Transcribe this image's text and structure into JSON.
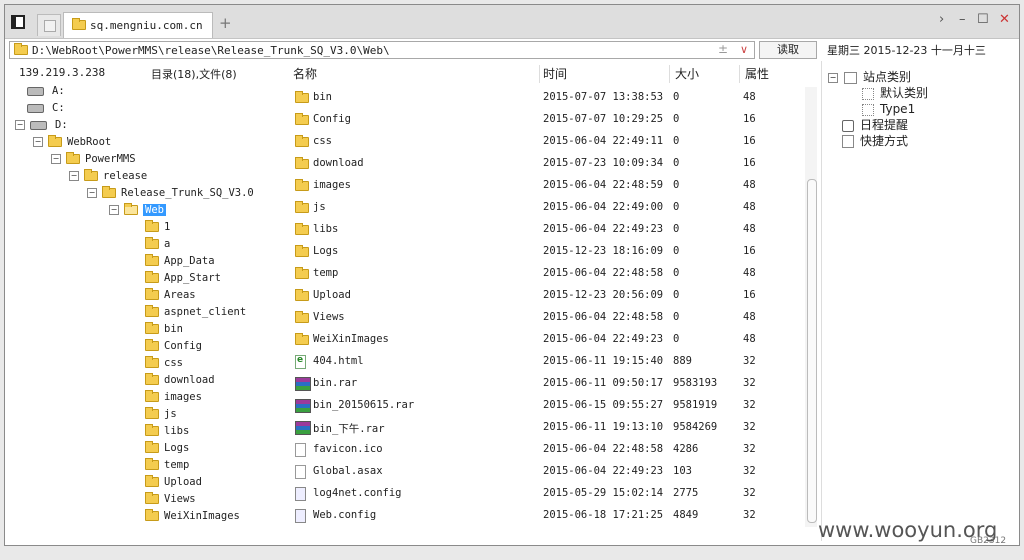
{
  "tabbar": {
    "tab_label": "sq.mengniu.com.cn",
    "plus": "+",
    "controls": [
      "›",
      "–",
      "☐",
      "✕"
    ]
  },
  "address": {
    "path": "D:\\WebRoot\\PowerMMS\\release\\Release_Trunk_SQ_V3.0\\Web\\",
    "read_label": "读取",
    "plus_minus": "±",
    "dropdown": "∨"
  },
  "date": "星期三  2015-12-23  十一月十三",
  "left": {
    "ip": "139.219.3.238",
    "count": "目录(18),文件(8)"
  },
  "tree": [
    {
      "label": "A:",
      "kind": "drive",
      "exp": ""
    },
    {
      "label": "C:",
      "kind": "drive",
      "exp": ""
    },
    {
      "label": "D:",
      "kind": "drive",
      "exp": "−"
    },
    {
      "label": "WebRoot",
      "kind": "folder",
      "exp": "−"
    },
    {
      "label": "PowerMMS",
      "kind": "folder",
      "exp": "−"
    },
    {
      "label": "release",
      "kind": "folder",
      "exp": "−"
    },
    {
      "label": "Release_Trunk_SQ_V3.0",
      "kind": "folder",
      "exp": "−"
    },
    {
      "label": "Web",
      "kind": "folder",
      "exp": "−",
      "selected": true
    },
    {
      "label": "1",
      "kind": "folder",
      "exp": ""
    },
    {
      "label": "a",
      "kind": "folder",
      "exp": ""
    },
    {
      "label": "App_Data",
      "kind": "folder",
      "exp": ""
    },
    {
      "label": "App_Start",
      "kind": "folder",
      "exp": ""
    },
    {
      "label": "Areas",
      "kind": "folder",
      "exp": ""
    },
    {
      "label": "aspnet_client",
      "kind": "folder",
      "exp": ""
    },
    {
      "label": "bin",
      "kind": "folder",
      "exp": ""
    },
    {
      "label": "Config",
      "kind": "folder",
      "exp": ""
    },
    {
      "label": "css",
      "kind": "folder",
      "exp": ""
    },
    {
      "label": "download",
      "kind": "folder",
      "exp": ""
    },
    {
      "label": "images",
      "kind": "folder",
      "exp": ""
    },
    {
      "label": "js",
      "kind": "folder",
      "exp": ""
    },
    {
      "label": "libs",
      "kind": "folder",
      "exp": ""
    },
    {
      "label": "Logs",
      "kind": "folder",
      "exp": ""
    },
    {
      "label": "temp",
      "kind": "folder",
      "exp": ""
    },
    {
      "label": "Upload",
      "kind": "folder",
      "exp": ""
    },
    {
      "label": "Views",
      "kind": "folder",
      "exp": ""
    },
    {
      "label": "WeiXinImages",
      "kind": "folder",
      "exp": ""
    }
  ],
  "columns": {
    "name": "名称",
    "time": "时间",
    "size": "大小",
    "attr": "属性"
  },
  "files": [
    {
      "name": "bin",
      "icon": "folder",
      "time": "2015-07-07 13:38:53",
      "size": "0",
      "attr": "48"
    },
    {
      "name": "Config",
      "icon": "folder",
      "time": "2015-07-07 10:29:25",
      "size": "0",
      "attr": "16"
    },
    {
      "name": "css",
      "icon": "folder",
      "time": "2015-06-04 22:49:11",
      "size": "0",
      "attr": "16"
    },
    {
      "name": "download",
      "icon": "folder",
      "time": "2015-07-23 10:09:34",
      "size": "0",
      "attr": "16"
    },
    {
      "name": "images",
      "icon": "folder",
      "time": "2015-06-04 22:48:59",
      "size": "0",
      "attr": "48"
    },
    {
      "name": "js",
      "icon": "folder",
      "time": "2015-06-04 22:49:00",
      "size": "0",
      "attr": "48"
    },
    {
      "name": "libs",
      "icon": "folder",
      "time": "2015-06-04 22:49:23",
      "size": "0",
      "attr": "48"
    },
    {
      "name": "Logs",
      "icon": "folder",
      "time": "2015-12-23 18:16:09",
      "size": "0",
      "attr": "16"
    },
    {
      "name": "temp",
      "icon": "folder",
      "time": "2015-06-04 22:48:58",
      "size": "0",
      "attr": "48"
    },
    {
      "name": "Upload",
      "icon": "folder",
      "time": "2015-12-23 20:56:09",
      "size": "0",
      "attr": "16"
    },
    {
      "name": "Views",
      "icon": "folder",
      "time": "2015-06-04 22:48:58",
      "size": "0",
      "attr": "48"
    },
    {
      "name": "WeiXinImages",
      "icon": "folder",
      "time": "2015-06-04 22:49:23",
      "size": "0",
      "attr": "48"
    },
    {
      "name": "404.html",
      "icon": "html",
      "time": "2015-06-11 19:15:40",
      "size": "889",
      "attr": "32"
    },
    {
      "name": "bin.rar",
      "icon": "rar",
      "time": "2015-06-11 09:50:17",
      "size": "9583193",
      "attr": "32"
    },
    {
      "name": "bin_20150615.rar",
      "icon": "rar",
      "time": "2015-06-15 09:55:27",
      "size": "9581919",
      "attr": "32"
    },
    {
      "name": "bin_下午.rar",
      "icon": "rar",
      "time": "2015-06-11 19:13:10",
      "size": "9584269",
      "attr": "32"
    },
    {
      "name": "favicon.ico",
      "icon": "file",
      "time": "2015-06-04 22:48:58",
      "size": "4286",
      "attr": "32"
    },
    {
      "name": "Global.asax",
      "icon": "file",
      "time": "2015-06-04 22:49:23",
      "size": "103",
      "attr": "32"
    },
    {
      "name": "log4net.config",
      "icon": "config",
      "time": "2015-05-29 15:02:14",
      "size": "2775",
      "attr": "32"
    },
    {
      "name": "Web.config",
      "icon": "config",
      "time": "2015-06-18 17:21:25",
      "size": "4849",
      "attr": "32"
    }
  ],
  "right": [
    {
      "label": "站点类别",
      "kind": "root"
    },
    {
      "label": "默认类别",
      "kind": "child"
    },
    {
      "label": "Type1",
      "kind": "child"
    },
    {
      "label": "日程提醒",
      "kind": "clock"
    },
    {
      "label": "快捷方式",
      "kind": "link"
    }
  ],
  "watermark": "www.wooyun.org",
  "gb": "GB2312"
}
